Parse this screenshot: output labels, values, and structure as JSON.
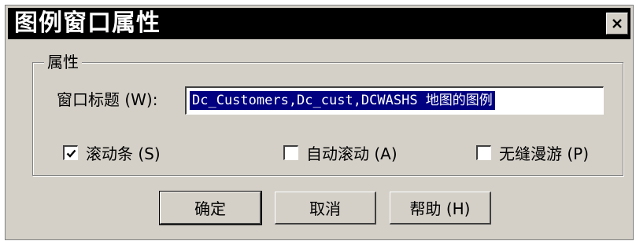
{
  "window": {
    "title": "图例窗口属性",
    "close_icon": "close-icon"
  },
  "group": {
    "label": "属性"
  },
  "title_field": {
    "label": "窗口标题 (W):",
    "value": "Dc_Customers,Dc_cust,DCWASHS 地图的图例"
  },
  "options": [
    {
      "label": "滚动条 (S)",
      "checked": true
    },
    {
      "label": "自动滚动 (A)",
      "checked": false
    },
    {
      "label": "无缝漫游 (P)",
      "checked": false
    }
  ],
  "buttons": {
    "ok": "确定",
    "cancel": "取消",
    "help": "帮助 (H)"
  },
  "colors": {
    "titlebar": "#000000",
    "face": "#d4d0c8",
    "selection": "#000080"
  }
}
